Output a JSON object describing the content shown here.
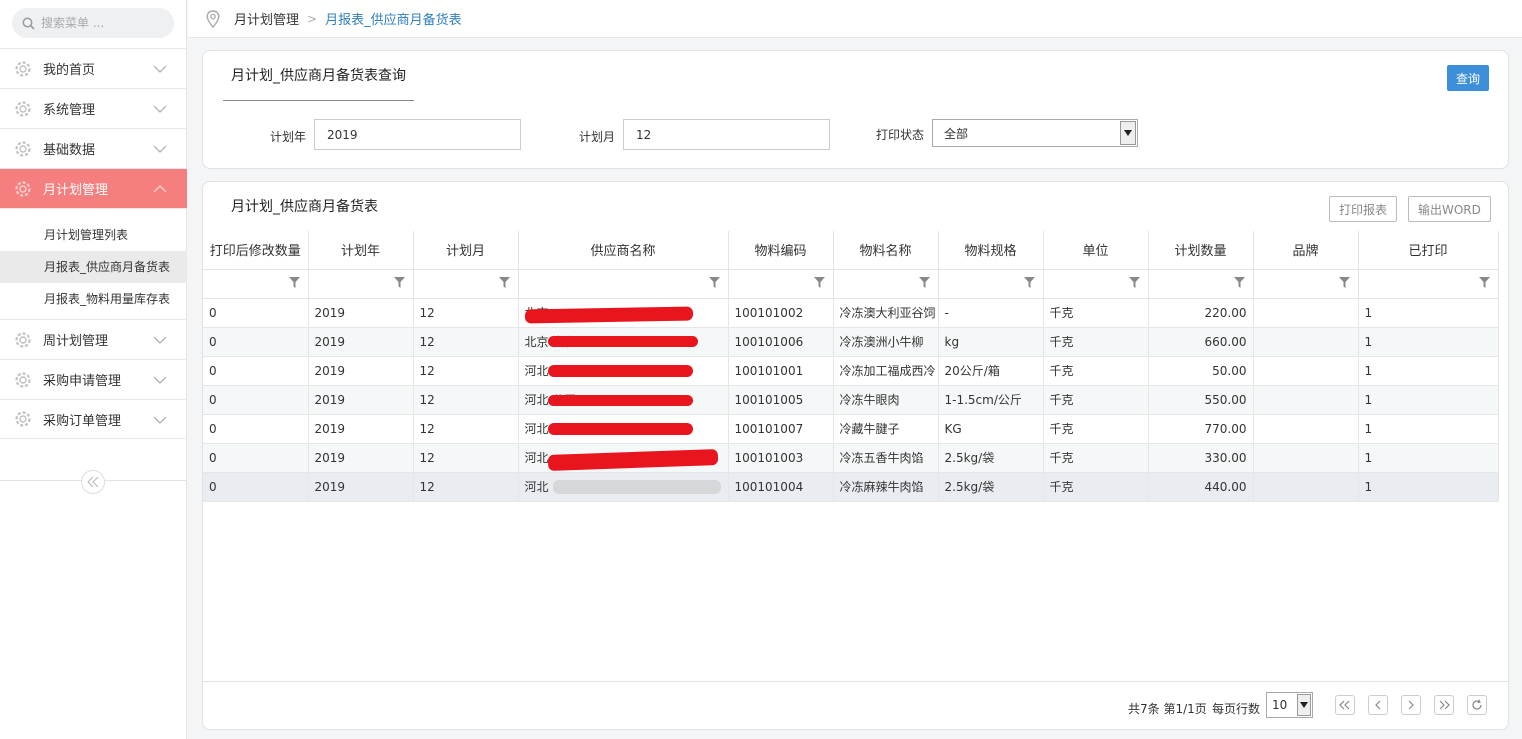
{
  "sidebar": {
    "search_placeholder": "搜索菜单 ...",
    "menu": [
      {
        "label": "我的首页"
      },
      {
        "label": "系统管理"
      },
      {
        "label": "基础数据"
      },
      {
        "label": "月计划管理",
        "active": true
      },
      {
        "label": "周计划管理"
      },
      {
        "label": "采购申请管理"
      },
      {
        "label": "采购订单管理"
      }
    ],
    "submenu": [
      {
        "label": "月计划管理列表"
      },
      {
        "label": "月报表_供应商月备货表",
        "selected": true
      },
      {
        "label": "月报表_物料用量库存表"
      }
    ]
  },
  "breadcrumb": {
    "parent": "月计划管理",
    "current": "月报表_供应商月备货表"
  },
  "query_panel": {
    "title": "月计划_供应商月备货表查询",
    "search_button": "查询",
    "fields": {
      "year_label": "计划年",
      "year_value": "2019",
      "month_label": "计划月",
      "month_value": "12",
      "print_status_label": "打印状态",
      "print_status_value": "全部"
    }
  },
  "table_panel": {
    "title": "月计划_供应商月备货表",
    "print_button": "打印报表",
    "export_button": "输出WORD",
    "columns": [
      "打印后修改数量",
      "计划年",
      "计划月",
      "供应商名称",
      "物料编码",
      "物料名称",
      "物料规格",
      "单位",
      "计划数量",
      "品牌",
      "已打印"
    ],
    "rows": [
      {
        "modified": "0",
        "year": "2019",
        "month": "12",
        "supplier": "北京",
        "code": "100101002",
        "name": "冷冻澳大利亚谷饲",
        "spec": "-",
        "unit": "千克",
        "qty": "220.00",
        "brand": "",
        "printed": "1"
      },
      {
        "modified": "0",
        "year": "2019",
        "month": "12",
        "supplier": "北京                    责任公司",
        "code": "100101006",
        "name": "冷冻澳洲小牛柳",
        "spec": "kg",
        "unit": "千克",
        "qty": "660.00",
        "brand": "",
        "printed": "1"
      },
      {
        "modified": "0",
        "year": "2019",
        "month": "12",
        "supplier": "河北                    公司",
        "code": "100101001",
        "name": "冷冻加工福成西冷",
        "spec": "20公斤/箱",
        "unit": "千克",
        "qty": "50.00",
        "brand": "",
        "printed": "1"
      },
      {
        "modified": "0",
        "year": "2019",
        "month": "12",
        "supplier": "河北                    公司",
        "code": "100101005",
        "name": "冷冻牛眼肉",
        "spec": "1-1.5cm/公斤",
        "unit": "千克",
        "qty": "550.00",
        "brand": "",
        "printed": "1"
      },
      {
        "modified": "0",
        "year": "2019",
        "month": "12",
        "supplier": "河北                    公司",
        "code": "100101007",
        "name": "冷藏牛腱子",
        "spec": "KG",
        "unit": "千克",
        "qty": "770.00",
        "brand": "",
        "printed": "1"
      },
      {
        "modified": "0",
        "year": "2019",
        "month": "12",
        "supplier": "河北",
        "code": "100101003",
        "name": "冷冻五香牛肉馅",
        "spec": "2.5kg/袋",
        "unit": "千克",
        "qty": "330.00",
        "brand": "",
        "printed": "1"
      },
      {
        "modified": "0",
        "year": "2019",
        "month": "12",
        "supplier": "河北",
        "code": "100101004",
        "name": "冷冻麻辣牛肉馅",
        "spec": "2.5kg/袋",
        "unit": "千克",
        "qty": "440.00",
        "brand": "",
        "printed": "1"
      }
    ]
  },
  "pager": {
    "summary": "共7条 第1/1页",
    "rows_per_page_label": "每页行数",
    "rows_per_page_value": "10"
  }
}
